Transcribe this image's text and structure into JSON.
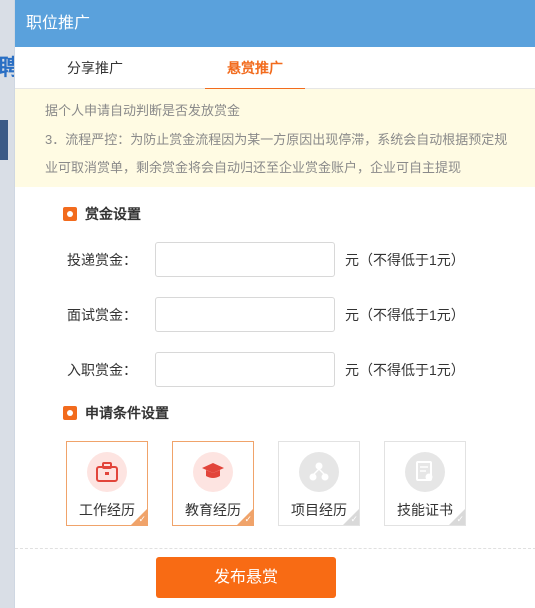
{
  "background": {
    "glyph": "聘"
  },
  "modal": {
    "title": "职位推广"
  },
  "tabs": [
    {
      "label": "分享推广"
    },
    {
      "label": "悬赏推广"
    }
  ],
  "notice": {
    "line1": "据个人申请自动判断是否发放赏金",
    "line2": "3．流程严控：为防止赏金流程因为某一方原因出现停滞，系统会自动根据预定规",
    "line3": "业可取消赏单，剩余赏金将会自动归还至企业赏金账户，企业可自主提现"
  },
  "reward_settings": {
    "title": "赏金设置",
    "rows": [
      {
        "label": "投递赏金：",
        "value": "",
        "hint": "元（不得低于1元）"
      },
      {
        "label": "面试赏金：",
        "value": "",
        "hint": "元（不得低于1元）"
      },
      {
        "label": "入职赏金：",
        "value": "",
        "hint": "元（不得低于1元）"
      }
    ]
  },
  "conditions": {
    "title": "申请条件设置",
    "items": [
      {
        "label": "工作经历",
        "icon": "briefcase-icon",
        "selected": true
      },
      {
        "label": "教育经历",
        "icon": "graduation-cap-icon",
        "selected": true
      },
      {
        "label": "项目经历",
        "icon": "network-icon",
        "selected": false
      },
      {
        "label": "技能证书",
        "icon": "certificate-icon",
        "selected": false
      }
    ]
  },
  "colors": {
    "header": "#5aa1dc",
    "accent": "#f26b1d",
    "publish": "#f86b14",
    "notice_bg": "#fffbe3"
  },
  "publish_button": {
    "label": "发布悬赏"
  }
}
